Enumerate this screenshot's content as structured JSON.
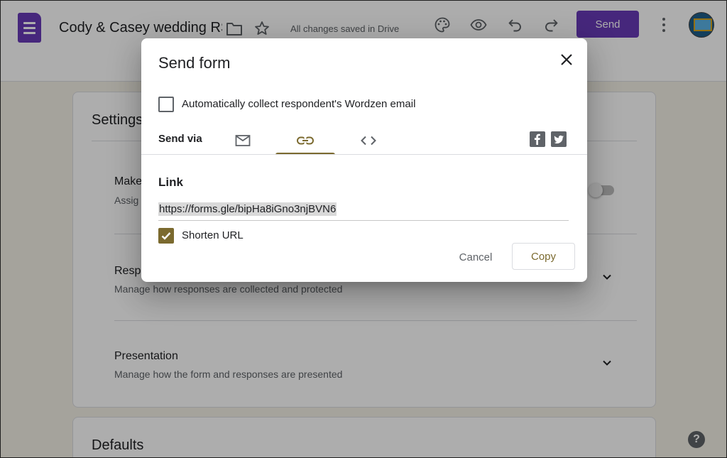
{
  "header": {
    "doc_title": "Cody & Casey wedding RS",
    "save_status": "All changes saved in Drive",
    "send_label": "Send",
    "icons": [
      "forms-logo",
      "folder-icon",
      "star-icon",
      "palette-icon",
      "eye-icon",
      "undo-icon",
      "redo-icon",
      "more-vert-icon",
      "avatar"
    ]
  },
  "settings": {
    "title": "Settings",
    "sections": [
      {
        "title": "Make",
        "subtitle": "Assig"
      },
      {
        "title": "Resp",
        "subtitle": "Manage how responses are collected and protected"
      },
      {
        "title": "Presentation",
        "subtitle": "Manage how the form and responses are presented"
      }
    ],
    "defaults_title": "Defaults"
  },
  "dialog": {
    "title": "Send form",
    "collect_email_label": "Automatically collect respondent's Wordzen email",
    "collect_email_checked": false,
    "send_via_label": "Send via",
    "tabs": [
      {
        "name": "email",
        "icon": "mail-icon",
        "active": false
      },
      {
        "name": "link",
        "icon": "link-icon",
        "active": true
      },
      {
        "name": "embed",
        "icon": "code-icon",
        "active": false
      }
    ],
    "social": [
      "facebook-icon",
      "twitter-icon"
    ],
    "link_heading": "Link",
    "link_url": "https://forms.gle/bipHa8iGno3njBVN6",
    "shorten_label": "Shorten URL",
    "shorten_checked": true,
    "cancel_label": "Cancel",
    "copy_label": "Copy"
  },
  "colors": {
    "brand_purple": "#673ab7",
    "accent_olive": "#7b6a2f",
    "background": "#f4f0e6"
  }
}
